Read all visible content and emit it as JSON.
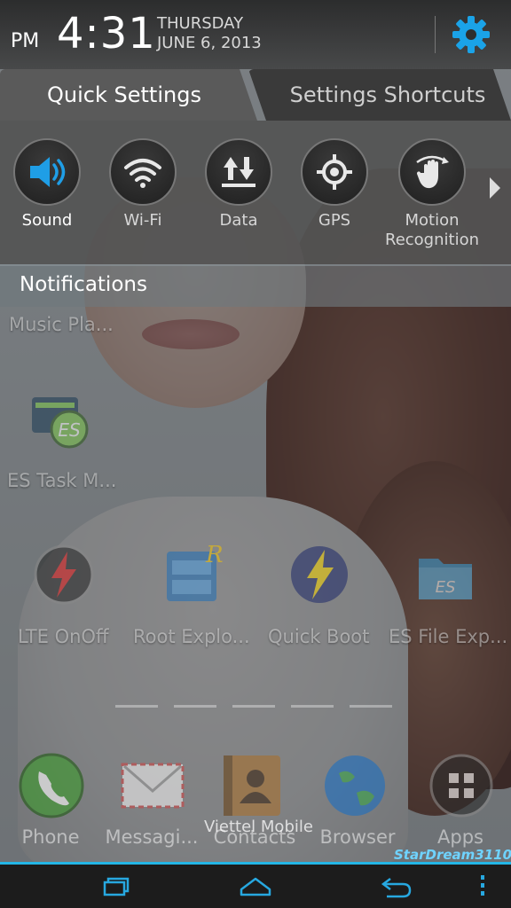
{
  "status": {
    "ampm": "PM",
    "time": "4:31",
    "day": "THURSDAY",
    "date": "JUNE 6, 2013"
  },
  "tabs": [
    {
      "label": "Quick Settings",
      "active": true
    },
    {
      "label": "Settings Shortcuts",
      "active": false
    }
  ],
  "quick_settings": [
    {
      "label": "Sound",
      "icon": "speaker-icon",
      "active": true
    },
    {
      "label": "Wi-Fi",
      "icon": "wifi-icon",
      "active": false
    },
    {
      "label": "Data",
      "icon": "data-arrows-icon",
      "active": false
    },
    {
      "label": "GPS",
      "icon": "gps-icon",
      "active": false
    },
    {
      "label": "Motion Recognition",
      "icon": "hand-motion-icon",
      "active": false
    }
  ],
  "notifications": {
    "title": "Notifications"
  },
  "home": {
    "labels": [
      "Music Pla...",
      "ES Task M...",
      "LTE OnOff",
      "Root Explo...",
      "Quick Boot",
      "ES File Exp..."
    ]
  },
  "dock": [
    "Phone",
    "Messagi...",
    "Contacts",
    "Browser",
    "Apps"
  ],
  "carrier": "Viettel Mobile",
  "watermark": "StarDream3110",
  "colors": {
    "accent": "#24b6e6",
    "sound_active": "#1f9ee6"
  }
}
